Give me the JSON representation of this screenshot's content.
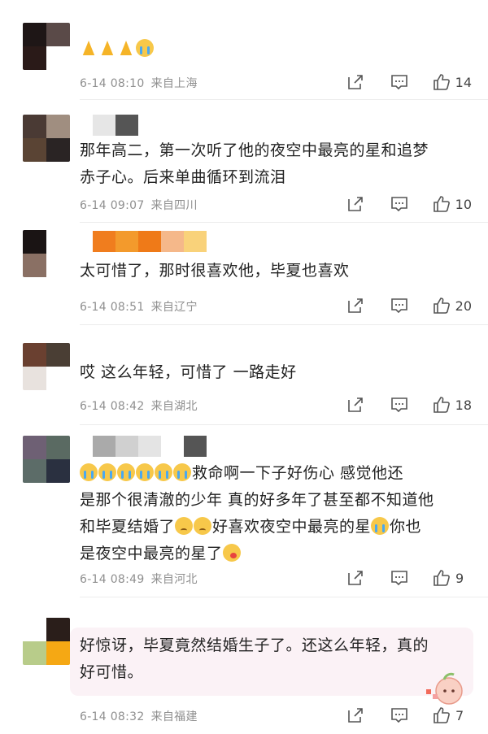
{
  "comments": [
    {
      "text": "",
      "emojis": [
        "pray",
        "pray",
        "pray",
        "cry"
      ],
      "time": "6-14 08:10",
      "location": "来自上海",
      "likes": "14",
      "avatar_colors": [
        "#1e1616",
        "#5a4a48",
        "#2a1a18",
        "#ffffff"
      ],
      "name_colors": []
    },
    {
      "text_lines": [
        "那年高二，第一次听了他的夜空中最亮的星和追梦",
        "赤子心。后来单曲循环到流泪"
      ],
      "time": "6-14 09:07",
      "location": "来自四川",
      "likes": "10",
      "avatar_colors": [
        "#4a3a34",
        "#a08e80",
        "#5a4434",
        "#2a2424"
      ],
      "name_colors": [
        "#e6e6e6",
        "#555555"
      ]
    },
    {
      "text": "太可惜了，那时很喜欢他，毕夏也喜欢",
      "time": "6-14 08:51",
      "location": "来自辽宁",
      "likes": "20",
      "avatar_colors": [
        "#1a1414",
        "#ffffff",
        "#8a7064",
        "#ffffff"
      ],
      "name_colors": [
        "#f07d1e",
        "#f39a2c",
        "#ef7a18",
        "#f5b88a",
        "#f9d27a"
      ]
    },
    {
      "text": "哎 这么年轻，可惜了 一路走好",
      "time": "6-14 08:42",
      "location": "来自湖北",
      "likes": "18",
      "avatar_colors": [
        "#6a4030",
        "#4a3e34",
        "#e8e2de",
        "#ffffff"
      ],
      "name_colors": []
    },
    {
      "text_lines": [
        "救命啊一下子好伤心 感觉他还",
        "是那个很清澈的少年 真的好多年了甚至都不知道他",
        "和毕夏结婚了",
        "好喜欢夜空中最亮的星",
        "你也",
        "是夜空中最亮的星了"
      ],
      "time": "6-14 08:49",
      "location": "来自河北",
      "likes": "9",
      "avatar_colors": [
        "#6e6074",
        "#5a6a62",
        "#5c6c68",
        "#2a3040"
      ],
      "name_colors": [
        "#aaaaaa",
        "#d0d0d0",
        "#e4e4e4",
        "#ffffff",
        "#555555"
      ]
    },
    {
      "text_lines": [
        "好惊讶，毕夏竟然结婚生子了。还这么年轻，真的",
        "好可惜。"
      ],
      "time": "6-14 08:32",
      "location": "来自福建",
      "likes": "7",
      "avatar_colors": [
        "#ffffff",
        "#2a1e1a",
        "#b8cc8a",
        "#f5a814"
      ],
      "name_colors": []
    }
  ],
  "icons": {
    "share": "share-icon",
    "reply": "comment-icon",
    "like": "thumbs-up-icon"
  },
  "colors": {
    "text": "#222222",
    "meta": "#8f8f8f",
    "icon": "#555555",
    "bubble": "#fbf2f6"
  }
}
